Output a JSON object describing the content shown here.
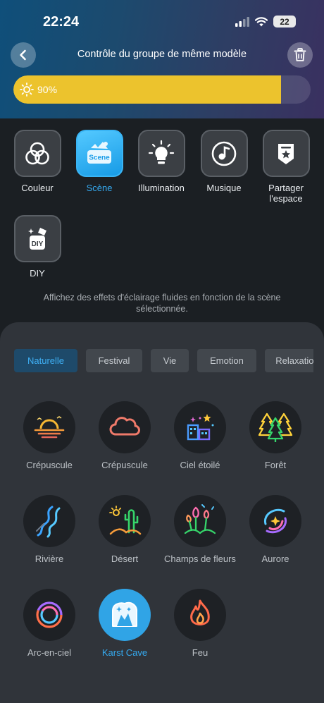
{
  "status": {
    "time": "22:24",
    "battery": "22"
  },
  "header": {
    "title": "Contrôle du groupe de même modèle"
  },
  "brightness": {
    "label": "90%",
    "level": 0.9,
    "color": "#ecc32d"
  },
  "modes": [
    {
      "label": "Couleur",
      "icon": "color-circles-icon",
      "active": false
    },
    {
      "label": "Scène",
      "icon": "scene-icon",
      "badge": "Scene",
      "active": true
    },
    {
      "label": "Illumination",
      "icon": "lightbulb-icon",
      "active": false
    },
    {
      "label": "Musique",
      "icon": "music-icon",
      "active": false
    },
    {
      "label": "Partager l'espace",
      "icon": "share-space-icon",
      "active": false
    },
    {
      "label": "DIY",
      "icon": "diy-icon",
      "badge": "DIY",
      "active": false
    }
  ],
  "hint": "Affichez des effets d'éclairage fluides en fonction de la scène sélectionnée.",
  "tabs": [
    {
      "label": "Naturelle",
      "active": true
    },
    {
      "label": "Festival",
      "active": false
    },
    {
      "label": "Vie",
      "active": false
    },
    {
      "label": "Emotion",
      "active": false
    },
    {
      "label": "Relaxation",
      "active": false
    }
  ],
  "scenes": [
    {
      "label": "Crépuscule",
      "icon": "sunset-icon",
      "active": false
    },
    {
      "label": "Crépuscule",
      "icon": "cloud-icon",
      "active": false
    },
    {
      "label": "Ciel étoilé",
      "icon": "starry-sky-icon",
      "active": false
    },
    {
      "label": "Forêt",
      "icon": "forest-icon",
      "active": false
    },
    {
      "label": "Rivière",
      "icon": "river-icon",
      "active": false
    },
    {
      "label": "Désert",
      "icon": "desert-icon",
      "active": false
    },
    {
      "label": "Champs de fleurs",
      "icon": "flower-field-icon",
      "active": false
    },
    {
      "label": "Aurore",
      "icon": "aurora-icon",
      "active": false
    },
    {
      "label": "Arc-en-ciel",
      "icon": "rainbow-icon",
      "active": false
    },
    {
      "label": "Karst Cave",
      "icon": "karst-cave-icon",
      "active": true
    },
    {
      "label": "Feu",
      "icon": "fire-icon",
      "active": false
    }
  ],
  "colors": {
    "accent": "#35aaf0",
    "brightness": "#ecc32d"
  }
}
